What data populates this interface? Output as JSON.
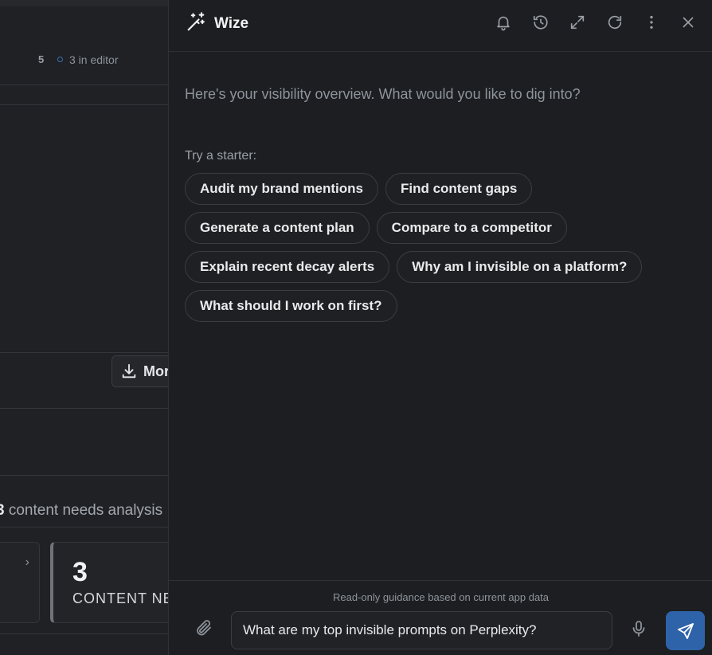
{
  "background_app": {
    "stats": {
      "count": "5",
      "in_editor": "3 in editor"
    },
    "download_label": "Mor",
    "analysis": {
      "count": "3",
      "text": "content needs analysis"
    },
    "card": {
      "number": "3",
      "label": "CONTENT NE"
    }
  },
  "panel": {
    "title": "Wize",
    "header_icons": [
      "bell-icon",
      "history-icon",
      "expand-icon",
      "refresh-icon",
      "more-vertical-icon",
      "close-icon"
    ],
    "greeting": "Here's your visibility overview. What would you like to dig into?",
    "starter_label": "Try a starter:",
    "starters": [
      "Audit my brand mentions",
      "Find content gaps",
      "Generate a content plan",
      "Compare to a competitor",
      "Explain recent decay alerts",
      "Why am I invisible on a platform?",
      "What should I work on first?"
    ],
    "footer_note": "Read-only guidance based on current app data",
    "input_value": "What are my top invisible prompts on Perplexity?"
  },
  "colors": {
    "accent": "#2e63a9",
    "panel_bg": "#1c1e21",
    "page_bg": "#1f2125"
  }
}
